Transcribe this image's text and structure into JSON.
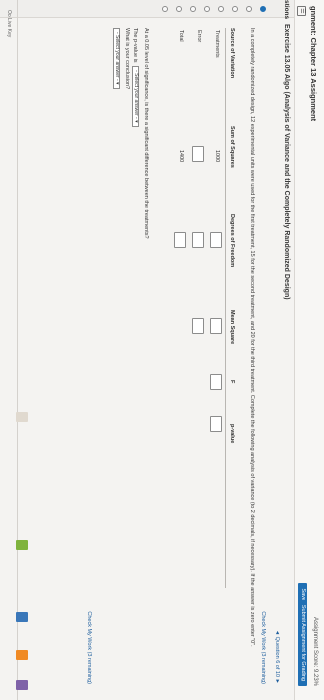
{
  "header": {
    "assignment_title": "gnment: Chapter 13 Assignment",
    "score": "Assignment Score: 9.23%",
    "save_label": "Save",
    "submit_label": "Submit Assignment for Grading"
  },
  "sidebar": {
    "label": "stions"
  },
  "exercise": {
    "title": "Exercise 13.05 Algo (Analysis of Variance and the Completely Randomized Design)",
    "question_nav": "◄ Question 6 of 10 ►",
    "check_work": "Check My Work (3 remaining)",
    "problem": "In a completely randomized design, 12 experimental units were used for the first treatment, 15 for the second treatment, and 20 for the third treatment. Complete the following analysis of variance (to 2 decimals, if necessary). If the answer is zero enter \"0\"."
  },
  "anova_table": {
    "headers": [
      "Source of Variation",
      "Sum of Squares",
      "Degrees of Freedom",
      "Mean Square",
      "F",
      "p-value"
    ],
    "rows": [
      {
        "label": "Treatments",
        "ss": "1000"
      },
      {
        "label": "Error",
        "ss": ""
      },
      {
        "label": "Total",
        "ss": "1400"
      }
    ]
  },
  "significance": {
    "question": "At a 0.05 level of significance, is there a significant difference between the treatments?",
    "pvalue_prefix": "The p-value is",
    "pvalue_select": "- Select your answer -",
    "conclusion_prompt": "What is your conclusion?",
    "conclusion_select": "- Select your answer -"
  },
  "footer": {
    "check_work": "Check My Work (3 remaining)",
    "status": "Oo Live Key"
  }
}
